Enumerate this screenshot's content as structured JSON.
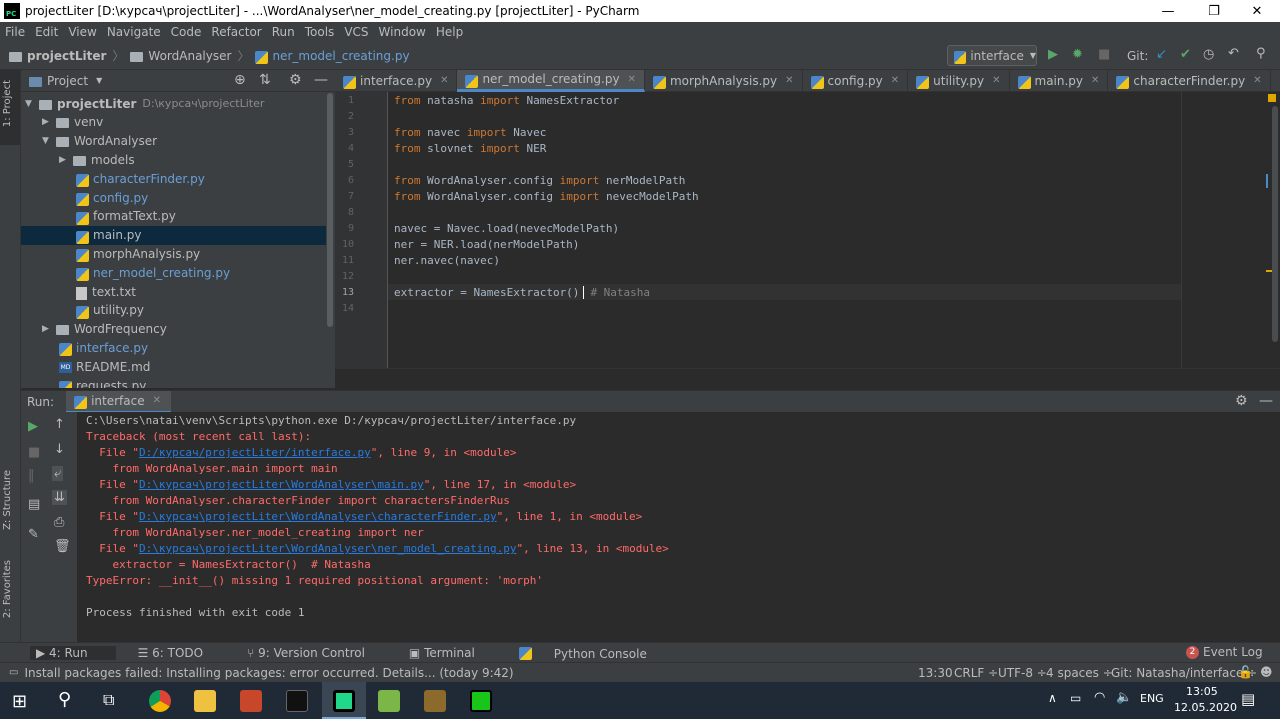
{
  "window": {
    "title": "projectLiter [D:\\курсач\\projectLiter] - ...\\WordAnalyser\\ner_model_creating.py [projectLiter] - PyCharm",
    "minimize": "—",
    "maximize": "❐",
    "close": "✕"
  },
  "menu": [
    "File",
    "Edit",
    "View",
    "Navigate",
    "Code",
    "Refactor",
    "Run",
    "Tools",
    "VCS",
    "Window",
    "Help"
  ],
  "navbar": {
    "crumbs": [
      "projectLiter",
      "WordAnalyser",
      "ner_model_creating.py"
    ],
    "run_config": "interface",
    "git_label": "Git:"
  },
  "left_strip": {
    "project_tab": "1: Project",
    "structure_tab": "Z: Structure",
    "favorites_tab": "2: Favorites"
  },
  "project_panel": {
    "title": "Project",
    "tree": [
      {
        "label": "projectLiter",
        "extra": "D:\\курсач\\projectLiter",
        "kind": "folder",
        "depth": 0,
        "arrow": "▼"
      },
      {
        "label": "venv",
        "kind": "folder",
        "depth": 1,
        "arrow": "▶"
      },
      {
        "label": "WordAnalyser",
        "kind": "folder",
        "depth": 1,
        "arrow": "▼"
      },
      {
        "label": "models",
        "kind": "folder",
        "depth": 2,
        "arrow": "▶"
      },
      {
        "label": "characterFinder.py",
        "kind": "py",
        "depth": 3
      },
      {
        "label": "config.py",
        "kind": "py",
        "depth": 3
      },
      {
        "label": "formatText.py",
        "kind": "py",
        "depth": 3
      },
      {
        "label": "main.py",
        "kind": "py",
        "depth": 3,
        "selected": true
      },
      {
        "label": "morphAnalysis.py",
        "kind": "py",
        "depth": 3
      },
      {
        "label": "ner_model_creating.py",
        "kind": "py",
        "depth": 3
      },
      {
        "label": "text.txt",
        "kind": "txt",
        "depth": 3
      },
      {
        "label": "utility.py",
        "kind": "py",
        "depth": 3
      },
      {
        "label": "WordFrequency",
        "kind": "folder",
        "depth": 1,
        "arrow": "▶"
      },
      {
        "label": "interface.py",
        "kind": "py",
        "depth": 2
      },
      {
        "label": "README.md",
        "kind": "md",
        "depth": 2
      },
      {
        "label": "requests.py",
        "kind": "py",
        "depth": 2
      }
    ]
  },
  "tabs": [
    {
      "label": "interface.py"
    },
    {
      "label": "ner_model_creating.py",
      "active": true
    },
    {
      "label": "morphAnalysis.py"
    },
    {
      "label": "config.py"
    },
    {
      "label": "utility.py"
    },
    {
      "label": "main.py"
    },
    {
      "label": "characterFinder.py"
    }
  ],
  "code": {
    "line_numbers": [
      "1",
      "2",
      "3",
      "4",
      "5",
      "6",
      "7",
      "8",
      "9",
      "10",
      "11",
      "12",
      "13",
      "14"
    ],
    "l1": {
      "kw1": "from",
      "mod": " natasha ",
      "kw2": "import",
      "name": " NamesExtractor"
    },
    "l3": {
      "kw1": "from",
      "mod": " navec ",
      "kw2": "import",
      "name": " Navec"
    },
    "l4": {
      "kw1": "from",
      "mod": " slovnet ",
      "kw2": "import",
      "name": " NER"
    },
    "l6": {
      "kw1": "from",
      "mod": " WordAnalyser.config ",
      "kw2": "import",
      "name": " nerModelPath"
    },
    "l7": {
      "kw1": "from",
      "mod": " WordAnalyser.config ",
      "kw2": "import",
      "name": " nevecModelPath"
    },
    "l9": "navec = Navec.load(nevecModelPath)",
    "l10": "ner = NER.load(nerModelPath)",
    "l11": "ner.navec(navec)",
    "l13_code": "extractor = NamesExtractor()",
    "l13_comment": "# Natasha"
  },
  "run": {
    "label": "Run:",
    "config": "interface",
    "lines": {
      "cmd": "C:\\Users\\natai\\venv\\Scripts\\python.exe D:/курсач/projectLiter/interface.py",
      "tb": "Traceback (most recent call last):",
      "f1_pre": "  File \"",
      "f1_link": "D:/курсач/projectLiter/interface.py",
      "f1_post": "\", line 9, in <module>",
      "s1": "    from WordAnalyser.main import main",
      "f2_pre": "  File \"",
      "f2_link": "D:\\курсач\\projectLiter\\WordAnalyser\\main.py",
      "f2_post": "\", line 17, in <module>",
      "s2": "    from WordAnalyser.characterFinder import charactersFinderRus",
      "f3_pre": "  File \"",
      "f3_link": "D:\\курсач\\projectLiter\\WordAnalyser\\characterFinder.py",
      "f3_post": "\", line 1, in <module>",
      "s3": "    from WordAnalyser.ner_model_creating import ner",
      "f4_pre": "  File \"",
      "f4_link": "D:\\курсач\\projectLiter\\WordAnalyser\\ner_model_creating.py",
      "f4_post": "\", line 13, in <module>",
      "s4": "    extractor = NamesExtractor()  # Natasha",
      "err": "TypeError: __init__() missing 1 required positional argument: 'morph'",
      "exit": "Process finished with exit code 1"
    }
  },
  "bottom_tabs": [
    {
      "label": "4: Run"
    },
    {
      "label": "6: TODO"
    },
    {
      "label": "9: Version Control"
    },
    {
      "label": "Terminal"
    },
    {
      "label": "Python Console"
    }
  ],
  "event_log": {
    "count": "2",
    "label": "Event Log"
  },
  "status": {
    "message": "Install packages failed: Installing packages: error occurred. Details... (today 9:42)",
    "position": "13:30",
    "line_sep": "CRLF ÷",
    "encoding": "UTF-8 ÷",
    "indent": "4 spaces ÷",
    "git": "Git: Natasha/interface ÷"
  },
  "taskbar": {
    "lang": "ENG",
    "time": "13:05",
    "date": "12.05.2020"
  },
  "colors": {
    "accent": "#4a88c7",
    "error": "#ff6b68",
    "link": "#287bde",
    "keyword": "#cc7832"
  }
}
